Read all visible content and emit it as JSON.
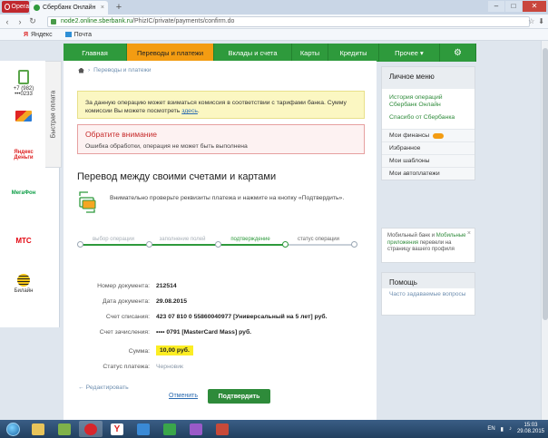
{
  "browser": {
    "menu_label": "Opera",
    "tab_title": "Сбербанк Онлайн",
    "tab_close": "×",
    "new_tab": "+",
    "url_domain": "node2.online.sberbank.ru",
    "url_path": "/PhizIC/private/payments/confirm.do",
    "bookmarks": [
      {
        "label": "Яндекс",
        "icon": "yandex-icon"
      },
      {
        "label": "Почта",
        "icon": "mail-icon"
      }
    ]
  },
  "fast_pay": {
    "label": "Быстрая оплата",
    "phone_number": "+7 (982) •••0233",
    "providers": [
      "Яндекс Деньги",
      "МегаФон",
      "МТС",
      "Билайн"
    ]
  },
  "nav": {
    "items": [
      "Главная",
      "Переводы и платежи",
      "Вклады и счета",
      "Карты",
      "Кредиты",
      "Прочее ▾"
    ],
    "active_index": 1,
    "settings_icon": "gear-icon"
  },
  "breadcrumb": {
    "home_icon": "home-icon",
    "separator": "›",
    "item": "Переводы и платежи"
  },
  "notice": {
    "text": "За данную операцию может взиматься комиссия в соответствии с тарифами банка. Сумму комиссии Вы можете посмотреть",
    "link": "здесь",
    "tail": "."
  },
  "warning": {
    "title": "Обратите внимание",
    "body": "Ошибка обработки, операция не может быть выполнена"
  },
  "page_title": "Перевод между своими счетами и картами",
  "instructions": "Внимательно проверьте реквизиты платежа и нажмите на кнопку «Подтвердить».",
  "steps": [
    {
      "label": "выбор операции",
      "state": "done"
    },
    {
      "label": "заполнение полей",
      "state": "done"
    },
    {
      "label": "подтверждение",
      "state": "active"
    },
    {
      "label": "статус операции",
      "state": "next"
    }
  ],
  "details": [
    {
      "key": "Номер документа:",
      "value": "212514",
      "style": "bold"
    },
    {
      "key": "Дата документа:",
      "value": "29.08.2015",
      "style": "bold"
    },
    {
      "key": "Счет списания:",
      "value": "423 07 810 0 55860040977  [Универсальный на 5 лет]  руб.",
      "style": "bold"
    },
    {
      "key": "Счет зачисления:",
      "value": "•••• 0791  [MasterCard Mass]  руб.",
      "style": "bold"
    },
    {
      "key": "Сумма:",
      "value": "10,00  руб.",
      "style": "amount"
    },
    {
      "key": "Статус платежа:",
      "value": "Черновик",
      "style": "status"
    }
  ],
  "actions": {
    "edit": "← Редактировать",
    "cancel": "Отменить",
    "confirm": "Подтвердить"
  },
  "sidebar": {
    "personal_menu": {
      "title": "Личное меню",
      "links": [
        "История операций Сбербанк Онлайн",
        "Спасибо от Сбербанка"
      ],
      "items": [
        "Мои финансы",
        "Избранное",
        "Мои шаблоны",
        "Мои автоплатежи"
      ]
    },
    "promo": {
      "pre": "Мобильный банк",
      "and": " и ",
      "apps": "Мобильные приложения",
      "post": " перевели на страницу вашего профиля",
      "close": "×"
    },
    "help": {
      "title": "Помощь",
      "link": "Часто задаваемые вопросы"
    }
  },
  "taskbar": {
    "language": "EN",
    "time": "15:03",
    "date": "29.08.2015"
  },
  "colors": {
    "brand_green": "#2e9a3c",
    "active_orange": "#f39c12",
    "error_red": "#c62828",
    "amount_highlight": "#fbed24"
  }
}
